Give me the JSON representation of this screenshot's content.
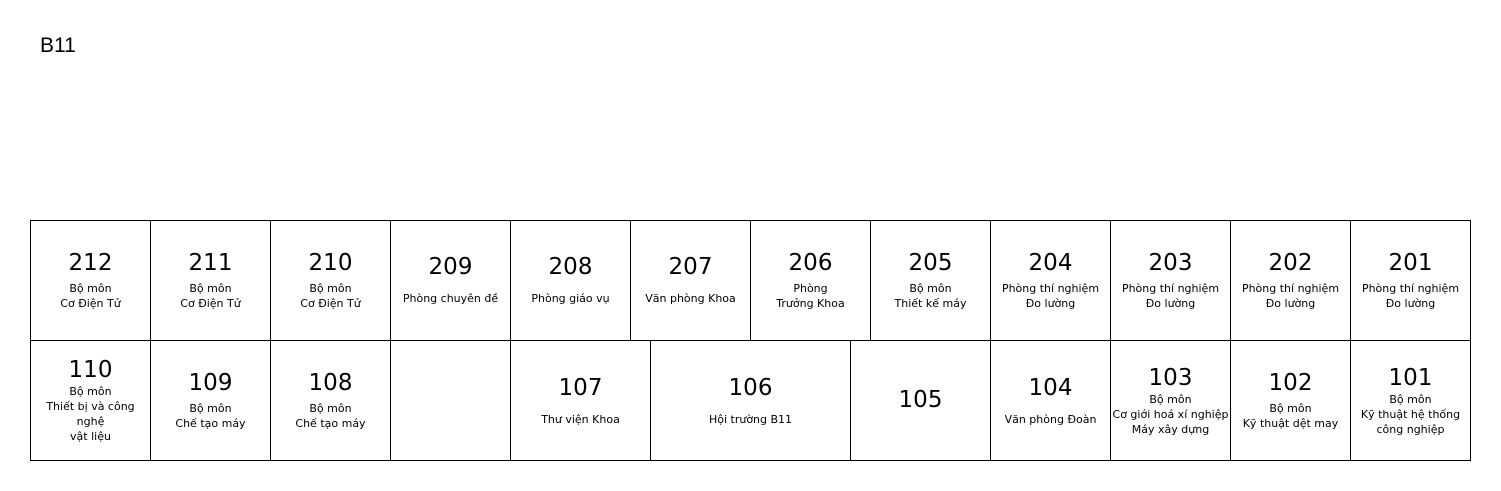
{
  "building": {
    "title": "B11"
  },
  "floor2": {
    "rooms": [
      {
        "number": "212",
        "desc": "Bộ môn\nCơ Điện Tử"
      },
      {
        "number": "211",
        "desc": "Bộ môn\nCơ Điện Tử"
      },
      {
        "number": "210",
        "desc": "Bộ môn\nCơ Điện Tử"
      },
      {
        "number": "209",
        "desc": "Phòng chuyên đề"
      },
      {
        "number": "208",
        "desc": "Phòng giáo vụ"
      },
      {
        "number": "207",
        "desc": "Văn phòng Khoa"
      },
      {
        "number": "206",
        "desc": "Phòng\nTrưởng Khoa"
      },
      {
        "number": "205",
        "desc": "Bộ môn\nThiết kế máy"
      },
      {
        "number": "204",
        "desc": "Phòng thí nghiệm\nĐo lường"
      },
      {
        "number": "203",
        "desc": "Phòng thí nghiệm\nĐo lường"
      },
      {
        "number": "202",
        "desc": "Phòng thí nghiệm\nĐo lường"
      },
      {
        "number": "201",
        "desc": "Phòng thí nghiệm\nĐo lường"
      }
    ]
  },
  "floor1": {
    "rooms": [
      {
        "number": "110",
        "desc": "Bộ môn\nThiết bị và công nghệ\nvật liệu"
      },
      {
        "number": "109",
        "desc": "Bộ môn\nChế tạo máy"
      },
      {
        "number": "108",
        "desc": "Bộ môn\nChế tạo máy"
      },
      {
        "number": "",
        "desc": ""
      },
      {
        "number": "107",
        "desc": "Thư viện Khoa"
      },
      {
        "number": "106",
        "desc": "Hội trường B11"
      },
      {
        "number": "105",
        "desc": ""
      },
      {
        "number": "104",
        "desc": "Văn phòng Đoàn"
      },
      {
        "number": "103",
        "desc": "Bộ môn\nCơ giới hoá xí nghiệp\nMáy xây dựng"
      },
      {
        "number": "102",
        "desc": "Bộ môn\nKỹ thuật dệt may"
      },
      {
        "number": "101",
        "desc": "Bộ môn\nKỹ thuật hệ thống\ncông nghiệp"
      }
    ]
  }
}
